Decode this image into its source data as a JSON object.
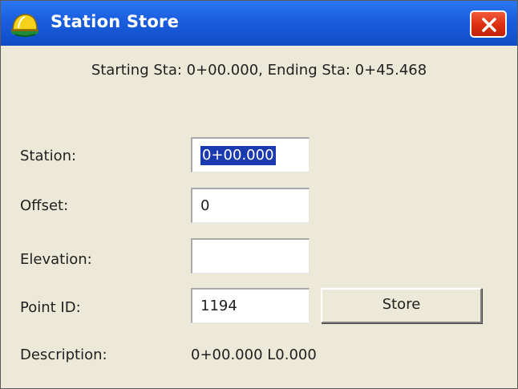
{
  "window": {
    "title": "Station Store",
    "close_symbol": "✕"
  },
  "header": {
    "station_range": "Starting Sta: 0+00.000, Ending Sta: 0+45.468"
  },
  "form": {
    "station": {
      "label": "Station:",
      "value": "0+00.000",
      "selected": true
    },
    "offset": {
      "label": "Offset:",
      "value": "0"
    },
    "elevation": {
      "label": "Elevation:",
      "value": ""
    },
    "point_id": {
      "label": "Point ID:",
      "value": "1194"
    },
    "description": {
      "label": "Description:",
      "value": "0+00.000 L0.000"
    }
  },
  "buttons": {
    "store": "Store"
  },
  "icons": {
    "app": "hardhat-icon",
    "close": "close-icon"
  },
  "colors": {
    "titlebar": "#1b5fe0",
    "close_button": "#dc2f10",
    "selection": "#1c3ab0",
    "window_bg": "#ece9d8"
  }
}
